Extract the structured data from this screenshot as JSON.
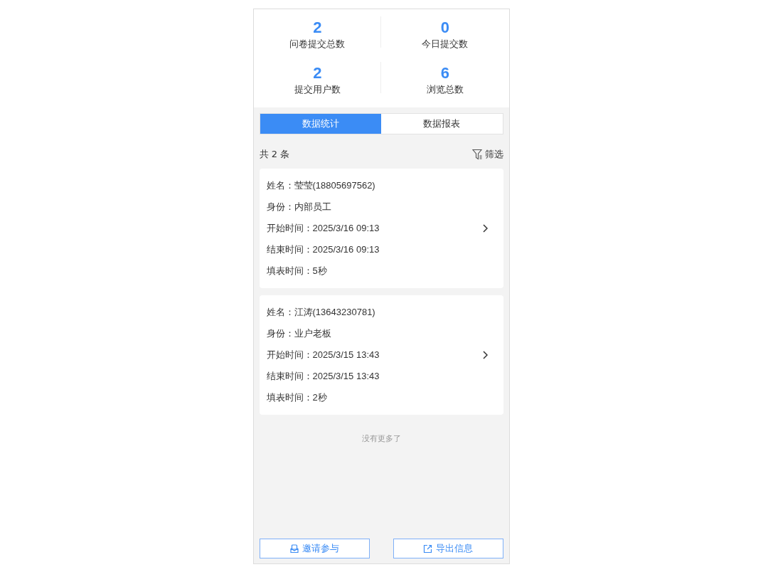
{
  "stats": [
    {
      "value": "2",
      "label": "问卷提交总数"
    },
    {
      "value": "0",
      "label": "今日提交数"
    },
    {
      "value": "2",
      "label": "提交用户数"
    },
    {
      "value": "6",
      "label": "浏览总数"
    }
  ],
  "tabs": [
    {
      "label": "数据统计",
      "selected": true
    },
    {
      "label": "数据报表",
      "selected": false
    }
  ],
  "count": "共 2 条",
  "filter": "筛选",
  "records": [
    {
      "lines": [
        "姓名：莹莹(18805697562)",
        "身份：内部员工",
        "开始时间：2025/3/16 09:13",
        "结束时间：2025/3/16 09:13",
        "填表时间：5秒"
      ]
    },
    {
      "lines": [
        "姓名：江涛(13643230781)",
        "身份：业户老板",
        "开始时间：2025/3/15 13:43",
        "结束时间：2025/3/15 13:43",
        "填表时间：2秒"
      ]
    }
  ],
  "end_note": "没有更多了",
  "buttons": [
    {
      "kind": "invite",
      "label": "邀请参与"
    },
    {
      "kind": "export",
      "label": "导出信息"
    }
  ]
}
